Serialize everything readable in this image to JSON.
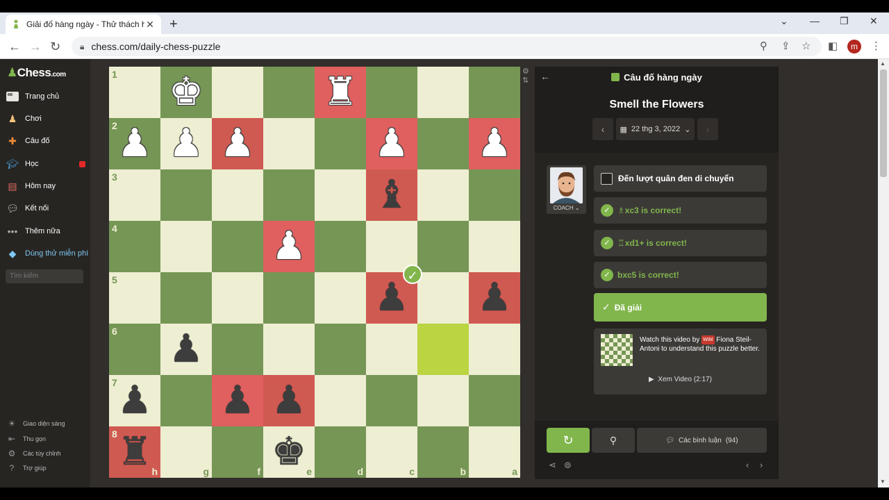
{
  "browser": {
    "tab_title": "Giải đố hàng ngày - Thử thách hà",
    "url": "chess.com/daily-chess-puzzle",
    "profile_initial": "m"
  },
  "sidebar": {
    "logo": "Chess",
    "logo_suffix": ".com",
    "items": [
      {
        "label": "Trang chủ",
        "icon": "home-icon"
      },
      {
        "label": "Chơi",
        "icon": "play-icon"
      },
      {
        "label": "Câu đố",
        "icon": "puzzle-icon"
      },
      {
        "label": "Học",
        "icon": "learn-icon"
      },
      {
        "label": "Hôm nay",
        "icon": "news-icon"
      },
      {
        "label": "Kết nối",
        "icon": "social-icon"
      },
      {
        "label": "Thêm nữa",
        "icon": "more-icon"
      },
      {
        "label": "Dùng thử miễn phí",
        "icon": "diamond-icon"
      }
    ],
    "search_placeholder": "Tìm kiếm",
    "bottom": [
      {
        "label": "Giao diện sáng",
        "icon": "sun-icon"
      },
      {
        "label": "Thu gọn",
        "icon": "collapse-icon"
      },
      {
        "label": "Các tùy chỉnh",
        "icon": "settings-icon"
      },
      {
        "label": "Trợ giúp",
        "icon": "help-icon"
      }
    ]
  },
  "board": {
    "ranks": [
      "1",
      "2",
      "3",
      "4",
      "5",
      "6",
      "7",
      "8"
    ],
    "files": [
      "h",
      "g",
      "f",
      "e",
      "d",
      "c",
      "b",
      "a"
    ]
  },
  "panel": {
    "header": "Câu đố hàng ngày",
    "puzzle_name": "Smell the Flowers",
    "date": "22 thg 3, 2022",
    "coach_label": "COACH",
    "turn_msg": "Đến lượt quân đen di chuyển",
    "moves": [
      {
        "piece": "♗",
        "text": "xc3 is correct!"
      },
      {
        "piece": "♖",
        "text": "xd1+ is correct!"
      },
      {
        "piece": "",
        "text": "bxc5 is correct!"
      }
    ],
    "solved": "Đã giải",
    "video_prefix": "Watch this video by",
    "video_title_badge": "WIM",
    "video_author": "Fiona Steil-Antoni",
    "video_suffix": "to understand this puzzle better.",
    "watch_label": "Xem Video (2:17)",
    "comments_label": "Các bình luận",
    "comments_count": "(94)"
  }
}
